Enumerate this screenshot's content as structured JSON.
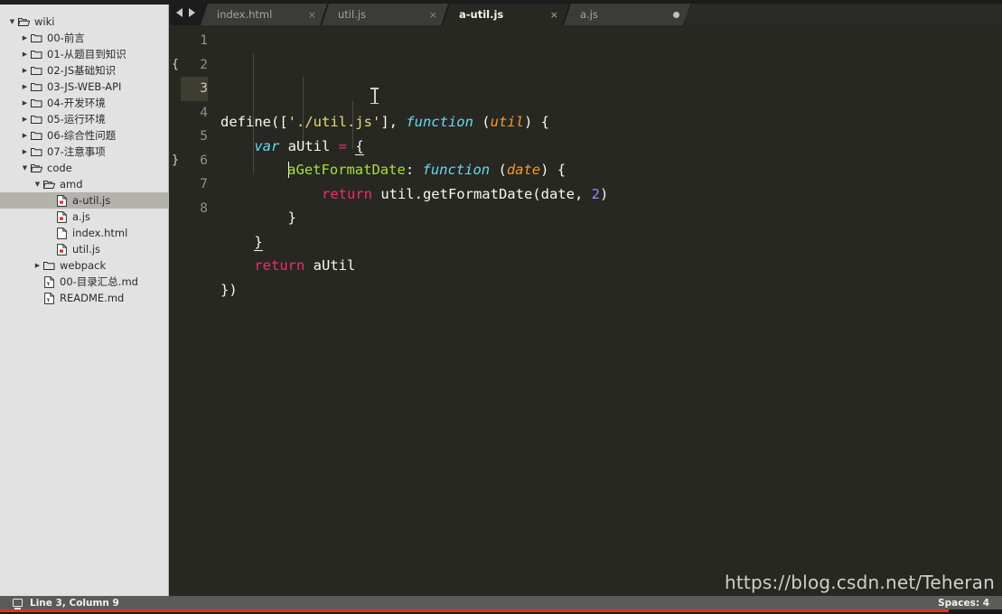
{
  "app": {
    "name": "Sublime Text",
    "theme_bg": "#272822",
    "sidebar_bg": "#e2e2e2",
    "accent_red": "#e8301a"
  },
  "sidebar": {
    "items": [
      {
        "label": "wiki",
        "type": "folder-open",
        "level": 0,
        "arrow": "down",
        "selected": false
      },
      {
        "label": "00-前言",
        "type": "folder",
        "level": 1,
        "arrow": "right",
        "selected": false
      },
      {
        "label": "01-从题目到知识",
        "type": "folder",
        "level": 1,
        "arrow": "right",
        "selected": false
      },
      {
        "label": "02-JS基础知识",
        "type": "folder",
        "level": 1,
        "arrow": "right",
        "selected": false
      },
      {
        "label": "03-JS-WEB-API",
        "type": "folder",
        "level": 1,
        "arrow": "right",
        "selected": false
      },
      {
        "label": "04-开发环境",
        "type": "folder",
        "level": 1,
        "arrow": "right",
        "selected": false
      },
      {
        "label": "05-运行环境",
        "type": "folder",
        "level": 1,
        "arrow": "right",
        "selected": false
      },
      {
        "label": "06-综合性问题",
        "type": "folder",
        "level": 1,
        "arrow": "right",
        "selected": false
      },
      {
        "label": "07-注意事项",
        "type": "folder",
        "level": 1,
        "arrow": "right",
        "selected": false
      },
      {
        "label": "code",
        "type": "folder-open",
        "level": 1,
        "arrow": "down",
        "selected": false
      },
      {
        "label": "amd",
        "type": "folder-open",
        "level": 2,
        "arrow": "down",
        "selected": false
      },
      {
        "label": "a-util.js",
        "type": "file-js",
        "level": 3,
        "arrow": "none",
        "selected": true
      },
      {
        "label": "a.js",
        "type": "file-js",
        "level": 3,
        "arrow": "none",
        "selected": false
      },
      {
        "label": "index.html",
        "type": "file",
        "level": 3,
        "arrow": "none",
        "selected": false
      },
      {
        "label": "util.js",
        "type": "file-js",
        "level": 3,
        "arrow": "none",
        "selected": false
      },
      {
        "label": "webpack",
        "type": "folder",
        "level": 2,
        "arrow": "right",
        "selected": false
      },
      {
        "label": "00-目录汇总.md",
        "type": "file-md",
        "level": 2,
        "arrow": "none",
        "selected": false
      },
      {
        "label": "README.md",
        "type": "file-md",
        "level": 2,
        "arrow": "none",
        "selected": false
      }
    ]
  },
  "tabs": {
    "nav_prev_icon": "triangle-left-icon",
    "nav_next_icon": "triangle-right-icon",
    "items": [
      {
        "label": "index.html",
        "active": false,
        "dirty": false,
        "close_glyph": "×"
      },
      {
        "label": "util.js",
        "active": false,
        "dirty": false,
        "close_glyph": "×"
      },
      {
        "label": "a-util.js",
        "active": true,
        "dirty": false,
        "close_glyph": "×"
      },
      {
        "label": "a.js",
        "active": false,
        "dirty": true,
        "close_glyph": "×"
      }
    ]
  },
  "editor": {
    "active_line": 3,
    "fold_markers": [
      "",
      "{",
      "",
      "",
      "",
      "}",
      "",
      ""
    ],
    "line_numbers": [
      "1",
      "2",
      "3",
      "4",
      "5",
      "6",
      "7",
      "8"
    ],
    "lines": [
      {
        "n": 1,
        "tokens": [
          {
            "t": "define([",
            "c": "plain"
          },
          {
            "t": "'./util.js'",
            "c": "str"
          },
          {
            "t": "], ",
            "c": "plain"
          },
          {
            "t": "function",
            "c": "kw"
          },
          {
            "t": " (",
            "c": "plain"
          },
          {
            "t": "util",
            "c": "param"
          },
          {
            "t": ") {",
            "c": "plain"
          }
        ]
      },
      {
        "n": 2,
        "tokens": [
          {
            "t": "    ",
            "c": "plain"
          },
          {
            "t": "var",
            "c": "kw"
          },
          {
            "t": " aUtil ",
            "c": "plain"
          },
          {
            "t": "=",
            "c": "op"
          },
          {
            "t": " ",
            "c": "plain"
          },
          {
            "t": "{",
            "c": "brmatch"
          }
        ]
      },
      {
        "n": 3,
        "tokens": [
          {
            "t": "        ",
            "c": "plain"
          },
          {
            "t": "CARET",
            "c": "caret"
          },
          {
            "t": "aGetFormatDate",
            "c": "fn"
          },
          {
            "t": ": ",
            "c": "plain"
          },
          {
            "t": "function",
            "c": "kw"
          },
          {
            "t": " (",
            "c": "plain"
          },
          {
            "t": "date",
            "c": "param"
          },
          {
            "t": ") {",
            "c": "plain"
          }
        ]
      },
      {
        "n": 4,
        "tokens": [
          {
            "t": "            ",
            "c": "plain"
          },
          {
            "t": "return",
            "c": "ret"
          },
          {
            "t": " util.getFormatDate(date, ",
            "c": "plain"
          },
          {
            "t": "2",
            "c": "num"
          },
          {
            "t": ")",
            "c": "plain"
          }
        ]
      },
      {
        "n": 5,
        "tokens": [
          {
            "t": "        }",
            "c": "plain"
          }
        ]
      },
      {
        "n": 6,
        "tokens": [
          {
            "t": "    ",
            "c": "plain"
          },
          {
            "t": "}",
            "c": "brmatch"
          }
        ]
      },
      {
        "n": 7,
        "tokens": [
          {
            "t": "    ",
            "c": "plain"
          },
          {
            "t": "return",
            "c": "ret"
          },
          {
            "t": " aUtil",
            "c": "plain"
          }
        ]
      },
      {
        "n": 8,
        "tokens": [
          {
            "t": "})",
            "c": "plain"
          }
        ]
      }
    ]
  },
  "statusbar": {
    "icon": "panel-icon",
    "position": "Line 3, Column 9",
    "spaces": "Spaces: 4"
  },
  "watermark": {
    "text": "https://blog.csdn.net/Teheran"
  }
}
